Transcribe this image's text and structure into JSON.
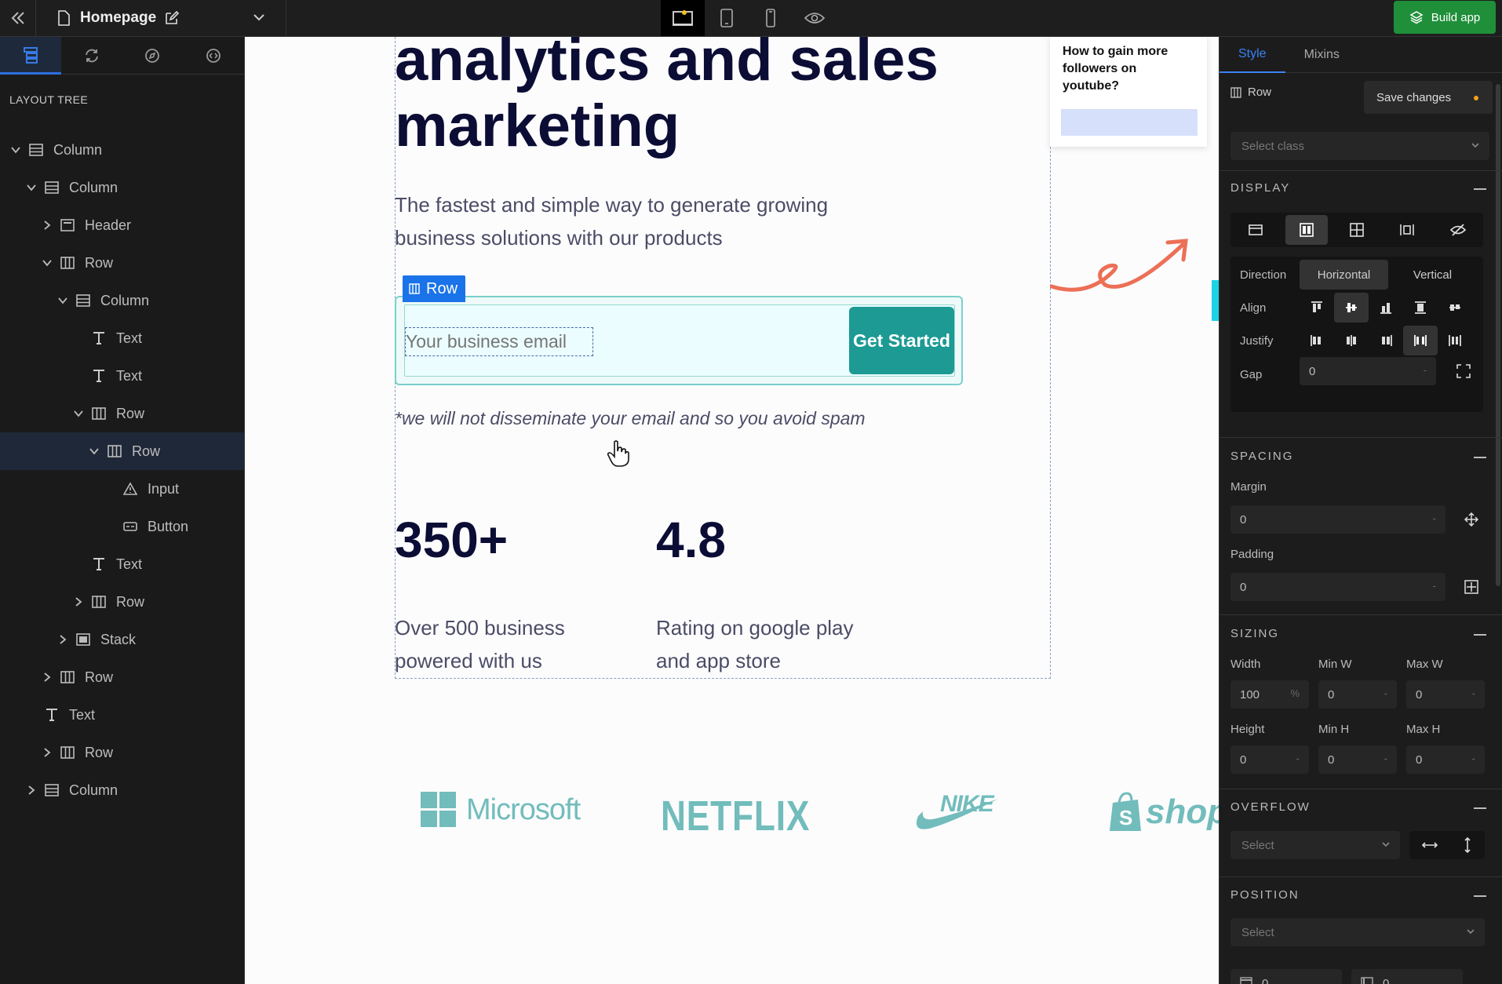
{
  "topbar": {
    "page_title": "Homepage",
    "build_label": "Build app"
  },
  "left_panel": {
    "tree_title": "LAYOUT TREE",
    "items": [
      {
        "label": "Column",
        "depth": 0,
        "expanded": true,
        "icon": "column-icon"
      },
      {
        "label": "Column",
        "depth": 1,
        "expanded": true,
        "icon": "column-icon"
      },
      {
        "label": "Header",
        "depth": 2,
        "expanded": false,
        "icon": "header-icon"
      },
      {
        "label": "Row",
        "depth": 2,
        "expanded": true,
        "icon": "row-icon"
      },
      {
        "label": "Column",
        "depth": 3,
        "expanded": true,
        "icon": "column-icon"
      },
      {
        "label": "Text",
        "depth": 4,
        "icon": "text-icon"
      },
      {
        "label": "Text",
        "depth": 4,
        "icon": "text-icon"
      },
      {
        "label": "Row",
        "depth": 4,
        "expanded": true,
        "icon": "row-icon"
      },
      {
        "label": "Row",
        "depth": 5,
        "expanded": true,
        "icon": "row-icon",
        "selected": true
      },
      {
        "label": "Input",
        "depth": 6,
        "icon": "input-icon"
      },
      {
        "label": "Button",
        "depth": 6,
        "icon": "button-icon"
      },
      {
        "label": "Text",
        "depth": 4,
        "icon": "text-icon"
      },
      {
        "label": "Row",
        "depth": 4,
        "expanded": false,
        "icon": "row-icon"
      },
      {
        "label": "Stack",
        "depth": 3,
        "expanded": false,
        "icon": "stack-icon"
      },
      {
        "label": "Row",
        "depth": 2,
        "expanded": false,
        "icon": "row-icon"
      },
      {
        "label": "Text",
        "depth": 1,
        "icon": "text-icon"
      },
      {
        "label": "Row",
        "depth": 2,
        "expanded": false,
        "icon": "row-icon"
      },
      {
        "label": "Column",
        "depth": 1,
        "expanded": false,
        "icon": "column-icon"
      }
    ]
  },
  "canvas": {
    "hero_line1": "analytics and sales",
    "hero_line2": "marketing",
    "hero_sub": "The fastest and simple way to generate growing business solutions with our products",
    "row_badge": "Row",
    "email_placeholder": "Your business email",
    "cta_label": "Get Started",
    "spam_note": "*we will not disseminate your email and so you avoid spam",
    "stats": [
      {
        "value": "350+",
        "desc": "Over 500 business powered with us"
      },
      {
        "value": "4.8",
        "desc": "Rating on google play and app store"
      }
    ],
    "card_text": "How to gain more followers on youtube?",
    "logos": [
      "Microsoft",
      "NETFLIX",
      "NIKE",
      "shop"
    ]
  },
  "right_panel": {
    "tabs": [
      "Style",
      "Mixins"
    ],
    "active_tab": "Style",
    "element_label": "Row",
    "save_label": "Save changes",
    "class_placeholder": "Select class",
    "display": {
      "heading": "DISPLAY",
      "direction_label": "Direction",
      "direction_options": [
        "Horizontal",
        "Vertical"
      ],
      "direction_selected": "Horizontal",
      "align_label": "Align",
      "justify_label": "Justify",
      "gap_label": "Gap",
      "gap_value": "0",
      "gap_unit": "-"
    },
    "spacing": {
      "heading": "SPACING",
      "margin_label": "Margin",
      "margin_value": "0",
      "padding_label": "Padding",
      "padding_value": "0",
      "unit": "-"
    },
    "sizing": {
      "heading": "SIZING",
      "width_label": "Width",
      "width_value": "100",
      "width_unit": "%",
      "minw_label": "Min W",
      "minw_value": "0",
      "maxw_label": "Max W",
      "maxw_value": "0",
      "height_label": "Height",
      "height_value": "0",
      "minh_label": "Min H",
      "minh_value": "0",
      "maxh_label": "Max H",
      "maxh_value": "0",
      "unit": "-"
    },
    "overflow": {
      "heading": "OVERFLOW",
      "select_placeholder": "Select"
    },
    "position": {
      "heading": "POSITION",
      "select_placeholder": "Select",
      "top_value": "0",
      "left_value": "0"
    }
  },
  "colors": {
    "accent": "#1a73e8",
    "build": "#1f8f3a",
    "cta": "#1c9a93",
    "hero_text": "#0b0d35",
    "logo": "#72bcbc",
    "tab_active": "#3b82f6"
  }
}
